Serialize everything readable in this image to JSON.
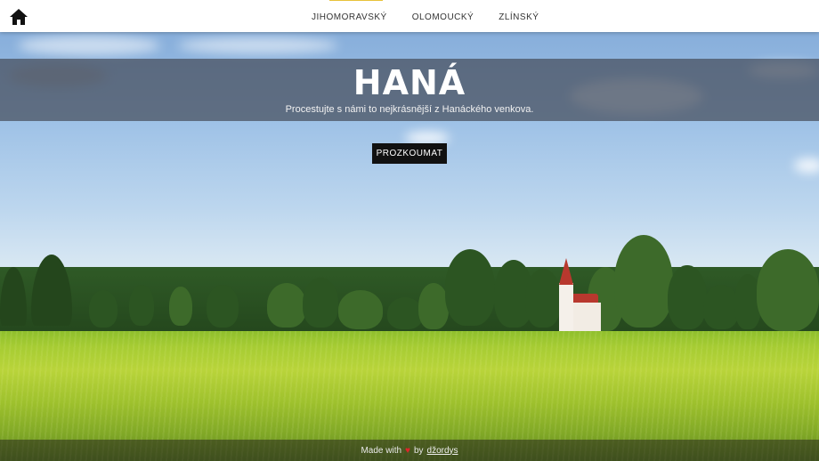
{
  "header": {
    "home_icon": "home-icon",
    "nav": [
      {
        "label": "JIHOMORAVSKÝ"
      },
      {
        "label": "OLOMOUCKÝ"
      },
      {
        "label": "ZLÍNSKÝ"
      }
    ],
    "accent_color": "#e8c23a"
  },
  "hero": {
    "title": "HANÁ",
    "subtitle": "Procestujte s námi to nejkrásnější z Hanáckého venkova.",
    "cta_label": "PROZKOUMAT"
  },
  "footer": {
    "prefix": "Made with",
    "heart_icon": "heart-icon",
    "by": "by",
    "author": "džordys"
  }
}
